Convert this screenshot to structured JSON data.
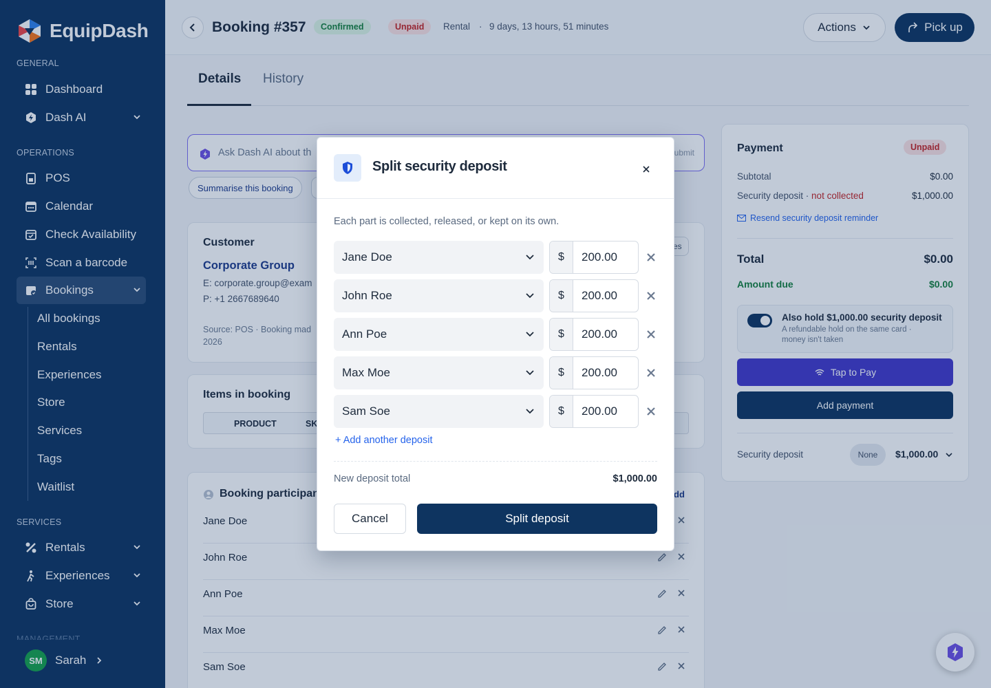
{
  "app": {
    "name": "EquipDash"
  },
  "sidebar": {
    "general_label": "GENERAL",
    "operations_label": "OPERATIONS",
    "services_label": "SERVICES",
    "management_label": "MANAGEMENT",
    "items": [
      {
        "label": "Dashboard",
        "icon": "grid-icon"
      },
      {
        "label": "Dash AI",
        "icon": "sparkle-icon"
      },
      {
        "label": "POS",
        "icon": "printer-icon"
      },
      {
        "label": "Calendar",
        "icon": "calendar-icon"
      },
      {
        "label": "Check Availability",
        "icon": "calendar-check-icon"
      },
      {
        "label": "Scan a barcode",
        "icon": "barcode-icon"
      },
      {
        "label": "Bookings",
        "icon": "calendar-bookings-icon"
      }
    ],
    "bookings_sub": [
      "All bookings",
      "Rentals",
      "Experiences",
      "Store",
      "Services",
      "Tags",
      "Waitlist"
    ],
    "services": [
      {
        "label": "Rentals",
        "icon": "tools-icon"
      },
      {
        "label": "Experiences",
        "icon": "hiker-icon"
      },
      {
        "label": "Store",
        "icon": "bag-icon"
      }
    ],
    "user": {
      "initials": "SM",
      "name": "Sarah"
    }
  },
  "header": {
    "title": "Booking #357",
    "status": "Confirmed",
    "payment_status": "Unpaid",
    "type": "Rental",
    "dot": "·",
    "duration": "9 days, 13 hours, 51 minutes",
    "actions_label": "Actions",
    "pickup_label": "Pick up"
  },
  "tabs": [
    "Details",
    "History"
  ],
  "ai": {
    "placeholder": "Ask Dash AI about th",
    "submit": "ubmit",
    "chip": "Summarise this booking"
  },
  "customer": {
    "heading": "Customer",
    "name": "Corporate Group",
    "email": "E: corporate.group@exam",
    "phone": "P: +1 2667689640",
    "source": "Source: POS  ·  Booking mad",
    "source_year": "2026",
    "notes_btn": "es"
  },
  "items": {
    "heading": "Items in booking",
    "col_product": "PRODUCT",
    "col_sku": "SK"
  },
  "participants": {
    "heading": "Booking participan",
    "add": "dd",
    "list": [
      "Jane Doe",
      "John Roe",
      "Ann Poe",
      "Max Moe",
      "Sam Soe"
    ]
  },
  "payment": {
    "heading": "Payment",
    "status": "Unpaid",
    "subtotal_label": "Subtotal",
    "subtotal": "$0.00",
    "deposit_label": "Security deposit · ",
    "deposit_status": "not collected",
    "deposit": "$1,000.00",
    "resend": "Resend security deposit reminder",
    "total_label": "Total",
    "total": "$0.00",
    "due_label": "Amount due",
    "due": "$0.00",
    "hold_title": "Also hold $1,000.00 security deposit",
    "hold_desc": "A refundable hold on the same card · money isn't taken",
    "tap_label": "Tap to Pay",
    "add_label": "Add payment",
    "sd_label": "Security deposit",
    "sd_badge": "None",
    "sd_value": "$1,000.00"
  },
  "modal": {
    "title": "Split security deposit",
    "description": "Each part is collected, released, or kept on its own.",
    "currency": "$",
    "parts": [
      {
        "name": "Jane Doe",
        "amount": "200.00"
      },
      {
        "name": "John Roe",
        "amount": "200.00"
      },
      {
        "name": "Ann Poe",
        "amount": "200.00"
      },
      {
        "name": "Max Moe",
        "amount": "200.00"
      },
      {
        "name": "Sam Soe",
        "amount": "200.00"
      }
    ],
    "add_label": "+ Add another deposit",
    "total_label": "New deposit total",
    "total": "$1,000.00",
    "cancel_label": "Cancel",
    "submit_label": "Split deposit"
  },
  "colors": {
    "brand_navy": "#0e3460",
    "accent_indigo": "#4338ca",
    "success": "#16803d",
    "danger": "#c52424",
    "link": "#2563eb"
  }
}
